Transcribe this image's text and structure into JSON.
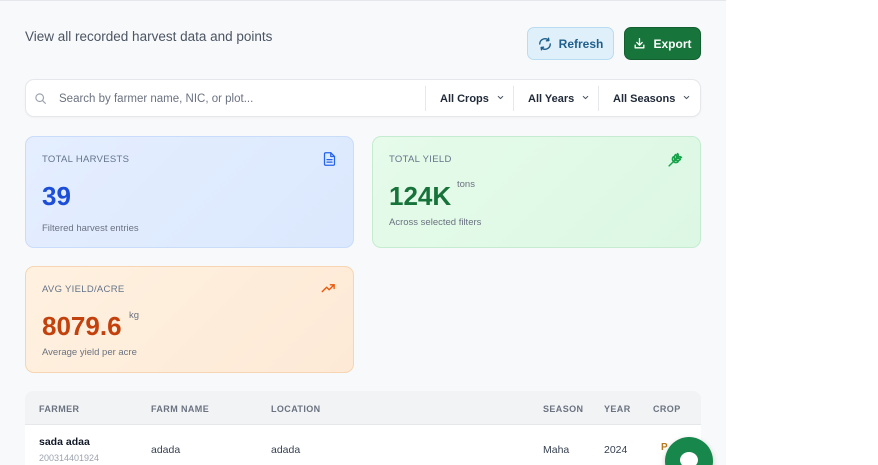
{
  "header": {
    "subtitle": "View all recorded harvest data and points",
    "refresh_label": "Refresh",
    "export_label": "Export"
  },
  "search": {
    "placeholder": "Search by farmer name, NIC, or plot...",
    "value": ""
  },
  "filters": {
    "crops": "All Crops",
    "years": "All Years",
    "seasons": "All Seasons"
  },
  "stats": {
    "total_harvests": {
      "label": "TOTAL HARVESTS",
      "value": "39",
      "sub": "Filtered harvest entries",
      "icon": "document-icon"
    },
    "total_yield": {
      "label": "TOTAL YIELD",
      "value": "124K",
      "unit": "tons",
      "sub": "Across selected filters",
      "icon": "wheat-icon"
    },
    "avg_yield": {
      "label": "AVG YIELD/ACRE",
      "value": "8079.6",
      "unit": "kg",
      "sub": "Average yield per acre",
      "icon": "trending-up-icon"
    }
  },
  "table": {
    "columns": [
      "FARMER",
      "FARM NAME",
      "LOCATION",
      "SEASON",
      "YEAR",
      "CROP"
    ],
    "rows": [
      {
        "farmer": "sada adaa",
        "nic": "200314401924",
        "farm_name": "adada",
        "location": "adada",
        "season": "Maha",
        "year": "2024",
        "crop": "P"
      }
    ]
  },
  "colors": {
    "primary_green": "#17743a",
    "accent_blue": "#1d4ed8",
    "accent_orange": "#c2410c"
  }
}
